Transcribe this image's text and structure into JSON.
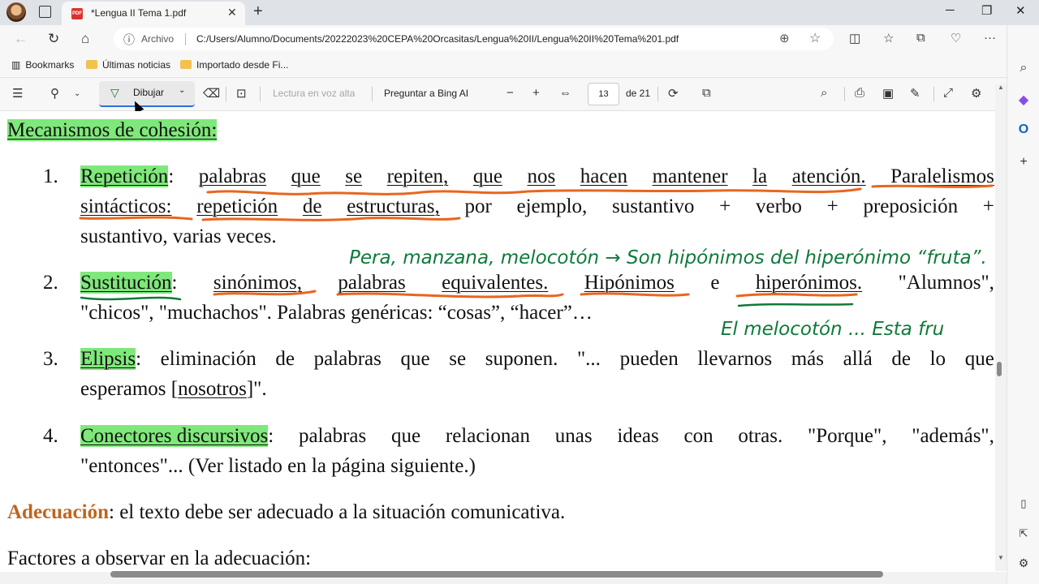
{
  "browser": {
    "tab_title": "*Lengua II Tema 1.pdf",
    "address_label": "Archivo",
    "url": "C:/Users/Alumno/Documents/20222023%20CEPA%20Orcasitas/Lengua%20II/Lengua%20II%20Tema%201.pdf",
    "bookmarks": [
      "Bookmarks",
      "Últimas noticias",
      "Importado desde Fi..."
    ]
  },
  "pdf_toolbar": {
    "draw_label": "Dibujar",
    "read_aloud": "Lectura en voz alta",
    "ask_bing": "Preguntar a Bing AI",
    "page_current": "13",
    "page_total": "de 21"
  },
  "document": {
    "heading": "Mecanismos de cohesión:",
    "items": [
      {
        "num": "1.",
        "term": "Repetición",
        "line1_words": [
          ":",
          "palabras",
          "que",
          "se",
          "repiten,",
          "que",
          "nos",
          "hacen",
          "mantener",
          "la",
          "atención.",
          "Paralelismos"
        ],
        "line2_words": [
          "sintácticos:",
          "repetición",
          "de",
          "estructuras,",
          "por",
          "ejemplo,",
          "sustantivo",
          "+",
          "verbo",
          "+",
          "preposición",
          "+"
        ],
        "line3": "sustantivo, varias veces."
      },
      {
        "num": "2.",
        "term": "Sustitución",
        "line1_words": [
          ":",
          "sinónimos,",
          "palabras",
          "equivalentes.",
          "Hipónimos",
          "e",
          "hiperónimos.",
          "\"Alumnos\","
        ],
        "line2": "\"chicos\", \"muchachos\". Palabras genéricas: “cosas”, “hacer”…"
      },
      {
        "num": "3.",
        "term": "Elipsis",
        "line1_words": [
          ":",
          "eliminación",
          "de",
          "palabras",
          "que",
          "se",
          "suponen.",
          "\"...",
          "pueden",
          "llevarnos",
          "más",
          "allá",
          "de",
          "lo",
          "que"
        ],
        "line2_pre": "esperamos [",
        "line2_ul": "nosotros",
        "line2_post": "]\"."
      },
      {
        "num": "4.",
        "term": "Conectores discursivos",
        "line1_words": [
          ":",
          "palabras",
          "que",
          "relacionan",
          "unas",
          "ideas",
          "con",
          "otras.",
          "\"Porque\",",
          "\"además\","
        ],
        "line2": "\"entonces\"... (Ver listado en la página siguiente.)"
      }
    ],
    "adecuacion_term": "Adecuación",
    "adecuacion_text": ": el texto debe ser adecuado a la situación comunicativa.",
    "factores": "Factores a observar en la adecuación:",
    "handwriting_1": "Pera, manzana, melocotón → Son hipónimos del hiperónimo “fruta”.",
    "handwriting_2": "El melocotón ... Esta fru"
  },
  "colors": {
    "highlight": "#7fe87a",
    "orange_ink": "#e8661f",
    "green_ink": "#0e7a3a",
    "adecuacion": "#c0651e"
  }
}
